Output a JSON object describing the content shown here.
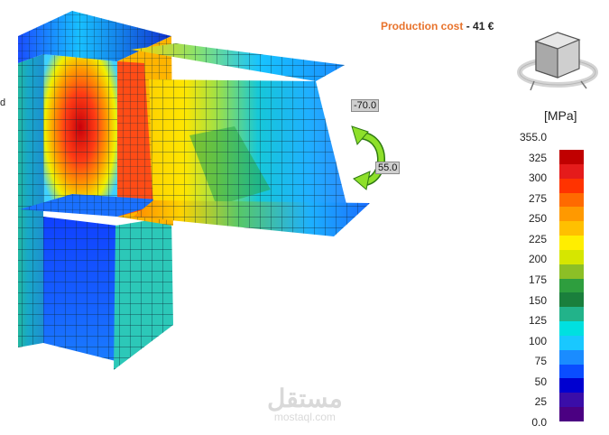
{
  "header": {
    "cost_label": "Production cost",
    "cost_separator": "-",
    "cost_value": "41 €"
  },
  "nav_cube": {
    "icon": "view-cube-icon"
  },
  "legend": {
    "unit": "[MPa]",
    "ticks": [
      "355.0",
      "325",
      "300",
      "275",
      "250",
      "225",
      "200",
      "175",
      "150",
      "125",
      "100",
      "75",
      "50",
      "25",
      "0.0"
    ],
    "colors": [
      "#c00000",
      "#e51b1b",
      "#ff3300",
      "#ff6a00",
      "#ff9900",
      "#ffc000",
      "#ffee00",
      "#d6e600",
      "#8cbf26",
      "#2e9e3e",
      "#1a7f3c",
      "#22b38a",
      "#00e0e0",
      "#19c8ff",
      "#1a8cff",
      "#0a4dff",
      "#0000d0",
      "#3a0da8",
      "#4b0082"
    ]
  },
  "model": {
    "load_label_top": "-70.0",
    "load_label_bottom": "55.0",
    "edge_label": "d"
  },
  "watermark": {
    "arabic": "مستقل",
    "latin": "mostaql.com"
  }
}
